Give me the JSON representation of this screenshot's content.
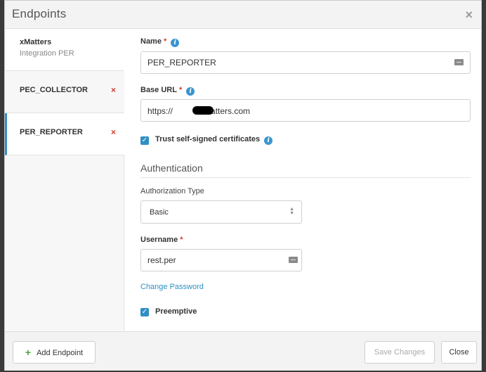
{
  "dialog": {
    "title": "Endpoints",
    "close_glyph": "×"
  },
  "sidebar": {
    "items": [
      {
        "name": "xMatters",
        "subtitle": "Integration PER",
        "deletable": false
      },
      {
        "name": "PEC_COLLECTOR",
        "deletable": true
      },
      {
        "name": "PER_REPORTER",
        "deletable": true,
        "selected": true
      }
    ],
    "delete_glyph": "×"
  },
  "form": {
    "name_label": "Name",
    "name_value": "PER_REPORTER",
    "base_url_label": "Base URL",
    "base_url_prefix": "https://",
    "base_url_suffix": "xmatters.com",
    "required_mark": "*",
    "info_glyph": "i",
    "trust_label": "Trust self-signed certificates",
    "trust_checked": true,
    "auth_section_title": "Authentication",
    "auth_type_label": "Authorization Type",
    "auth_type_value": "Basic",
    "username_label": "Username",
    "username_value": "rest.per",
    "change_password_link": "Change Password",
    "preemptive_label": "Preemptive",
    "preemptive_checked": true,
    "check_glyph": "✓"
  },
  "footer": {
    "add_glyph": "+",
    "add_endpoint_label": "Add Endpoint",
    "save_changes_label": "Save Changes",
    "close_label": "Close"
  },
  "colors": {
    "accent": "#2f8fc5",
    "delete": "#d13b2f",
    "add": "#4aa33a"
  }
}
